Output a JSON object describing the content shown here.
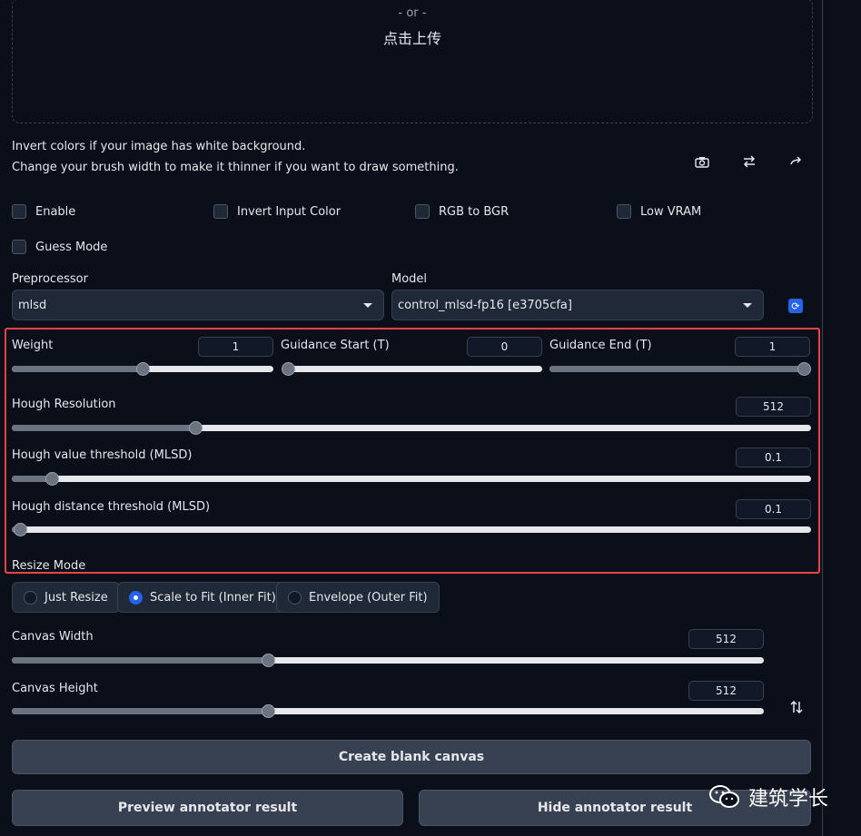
{
  "upload": {
    "or_text": "- or -",
    "click_text": "点击上传"
  },
  "hints": {
    "line1": "Invert colors if your image has white background.",
    "line2": "Change your brush width to make it thinner if you want to draw something."
  },
  "toolbar": {
    "icons": [
      "camera-icon",
      "swap-icon",
      "arrow-icon"
    ]
  },
  "checkboxes": {
    "enable": "Enable",
    "invert": "Invert Input Color",
    "rgb_bgr": "RGB to BGR",
    "low_vram": "Low VRAM",
    "guess": "Guess Mode"
  },
  "preprocessor": {
    "label": "Preprocessor",
    "value": "mlsd"
  },
  "model": {
    "label": "Model",
    "value": "control_mlsd-fp16 [e3705cfa]"
  },
  "sliders": {
    "weight": {
      "label": "Weight",
      "value": "1",
      "fraction": 0.5
    },
    "guidance_start": {
      "label": "Guidance Start (T)",
      "value": "0",
      "fraction": 0.0
    },
    "guidance_end": {
      "label": "Guidance End (T)",
      "value": "1",
      "fraction": 1.0
    },
    "hough_res": {
      "label": "Hough Resolution",
      "value": "512",
      "fraction": 0.23
    },
    "hough_value": {
      "label": "Hough value threshold (MLSD)",
      "value": "0.1",
      "fraction": 0.05
    },
    "hough_dist": {
      "label": "Hough distance threshold (MLSD)",
      "value": "0.1",
      "fraction": 0.01
    },
    "canvas_w": {
      "label": "Canvas Width",
      "value": "512",
      "fraction": 0.34
    },
    "canvas_h": {
      "label": "Canvas Height",
      "value": "512",
      "fraction": 0.34
    }
  },
  "resize": {
    "label": "Resize Mode",
    "options": [
      "Just Resize",
      "Scale to Fit (Inner Fit)",
      "Envelope (Outer Fit)"
    ],
    "selected": "Scale to Fit (Inner Fit)"
  },
  "buttons": {
    "create": "Create blank canvas",
    "preview": "Preview annotator result",
    "hide": "Hide annotator result"
  },
  "watermark": {
    "text": "建筑学长"
  },
  "colors": {
    "accent": "#2563eb",
    "highlight": "#ef4444",
    "bg": "#0b0f19"
  }
}
